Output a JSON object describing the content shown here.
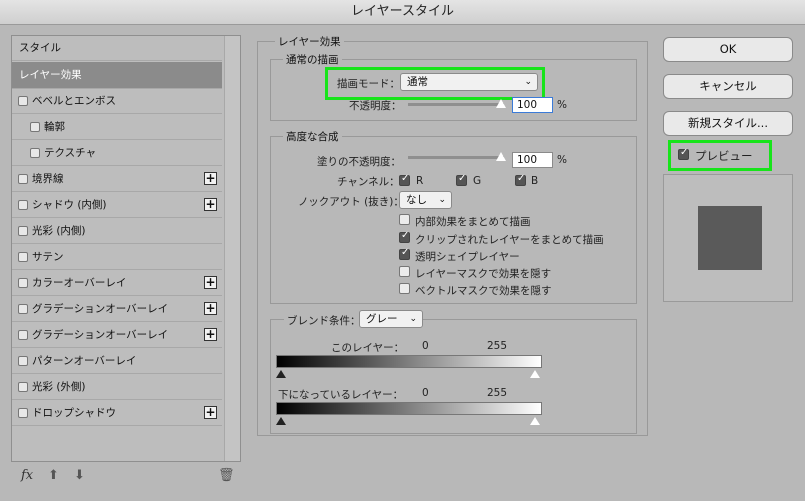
{
  "window": {
    "title": "レイヤースタイル"
  },
  "sidebar": {
    "items": [
      {
        "label": "スタイル"
      },
      {
        "label": "レイヤー効果"
      },
      {
        "label": "ベベルとエンボス"
      },
      {
        "label": "輪郭"
      },
      {
        "label": "テクスチャ"
      },
      {
        "label": "境界線"
      },
      {
        "label": "シャドウ (内側)"
      },
      {
        "label": "光彩 (内側)"
      },
      {
        "label": "サテン"
      },
      {
        "label": "カラーオーバーレイ"
      },
      {
        "label": "グラデーションオーバーレイ"
      },
      {
        "label": "グラデーションオーバーレイ"
      },
      {
        "label": "パターンオーバーレイ"
      },
      {
        "label": "光彩 (外側)"
      },
      {
        "label": "ドロップシャドウ"
      }
    ],
    "footer_fx": "fx"
  },
  "layer_effects": {
    "title": "レイヤー効果",
    "normal_blend": {
      "legend": "通常の描画",
      "mode_label": "描画モード：",
      "mode_value": "通常",
      "opacity_label": "不透明度：",
      "opacity_value": "100",
      "opacity_unit": "%"
    },
    "advanced": {
      "legend": "高度な合成",
      "fill_opacity_label": "塗りの不透明度：",
      "fill_opacity_value": "100",
      "fill_unit": "%",
      "channels_label": "チャンネル：",
      "channel_r": "R",
      "channel_g": "G",
      "channel_b": "B",
      "knockout_label": "ノックアウト (抜き)：",
      "knockout_value": "なし",
      "options": [
        {
          "label": "内部効果をまとめて描画",
          "checked": false
        },
        {
          "label": "クリップされたレイヤーをまとめて描画",
          "checked": true
        },
        {
          "label": "透明シェイプレイヤー",
          "checked": true
        },
        {
          "label": "レイヤーマスクで効果を隠す",
          "checked": false
        },
        {
          "label": "ベクトルマスクで効果を隠す",
          "checked": false
        }
      ]
    },
    "blend_if": {
      "label": "ブレンド条件：",
      "value": "グレー",
      "this_layer_label": "このレイヤー：",
      "this_layer_min": "0",
      "this_layer_max": "255",
      "underlying_label": "下になっているレイヤー：",
      "underlying_min": "0",
      "underlying_max": "255"
    }
  },
  "buttons": {
    "ok": "OK",
    "cancel": "キャンセル",
    "new_style": "新規スタイル...",
    "preview": "プレビュー"
  },
  "colors": {
    "highlight": "#17e41a",
    "preview_swatch": "#5a5a5a"
  }
}
